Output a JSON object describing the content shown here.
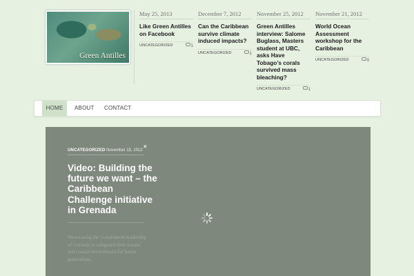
{
  "site": {
    "logo_text": "Green Antilles"
  },
  "recent_posts": [
    {
      "date": "May 25, 2013",
      "title": "Like Green Antilles on Facebook",
      "category": "UNCATEGORIZED",
      "comments": "1"
    },
    {
      "date": "December 7, 2012",
      "title": "Can the Caribbean survive climate induced impacts?",
      "category": "UNCATEGORIZED",
      "comments": "1"
    },
    {
      "date": "November 25, 2012",
      "title": "Green Antilles interview: Salome Buglass, Masters student at UBC, asks Have Tobago’s corals survived mass bleaching?",
      "category": "UNCATEGORIZED",
      "comments": "1"
    },
    {
      "date": "November 21, 2012",
      "title": "World Ocean Assessment workshop for the Caribbean",
      "category": "UNCATEGORIZED",
      "comments": "0"
    }
  ],
  "nav": {
    "items": [
      "HOME",
      "ABOUT",
      "CONTACT"
    ]
  },
  "featured": {
    "category": "UNCATEGORIZED",
    "date": "November 15, 2012",
    "close": "×",
    "title": "Video: Building the future we want – the Caribbean Challenge initiative in Grenada",
    "excerpt": "Showcasing the Government leadership of Grenada to safeguard their marine and coastal environment for future generations."
  },
  "icons": {
    "comments": "speech-bubble-icon",
    "close": "close-icon",
    "loading": "spinner-icon"
  }
}
